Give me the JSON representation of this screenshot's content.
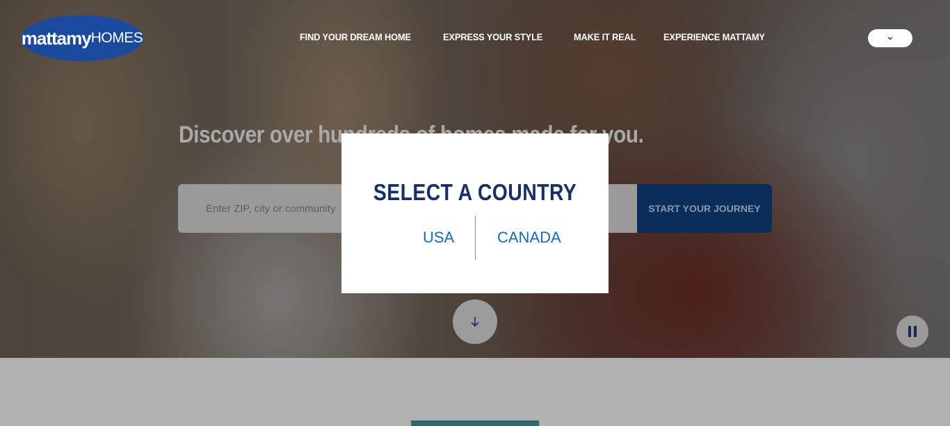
{
  "brand": {
    "name_bold": "mattamy",
    "name_light": "HOMES",
    "color": "#1a4aa0"
  },
  "nav": {
    "items": [
      "FIND YOUR DREAM HOME",
      "EXPRESS YOUR STYLE",
      "MAKE IT REAL",
      "EXPERIENCE MATTAMY"
    ]
  },
  "language_selector": {
    "icon": "chevron-down-icon"
  },
  "hero": {
    "headline": "Discover over hundreds of homes made for you.",
    "search_placeholder": "Enter ZIP, city or community",
    "start_button": "START YOUR JOURNEY",
    "scroll_icon": "arrow-down-icon",
    "pause_icon": "pause-icon"
  },
  "modal": {
    "title": "SELECT A COUNTRY",
    "options": [
      "USA",
      "CANADA"
    ]
  },
  "colors": {
    "primary_navy": "#14306a",
    "link_blue": "#1568c4",
    "teal": "#2b6a6c"
  }
}
